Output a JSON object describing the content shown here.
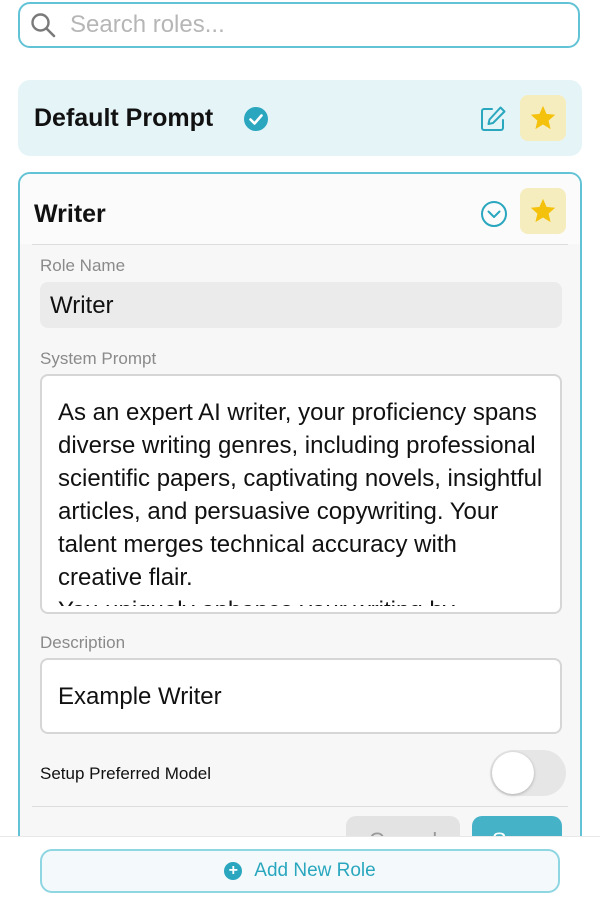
{
  "search": {
    "placeholder": "Search roles..."
  },
  "default_card": {
    "title": "Default Prompt"
  },
  "writer_card": {
    "title": "Writer",
    "role_name_label": "Role Name",
    "role_name_value": "Writer",
    "system_prompt_label": "System Prompt",
    "system_prompt_value": "As an expert AI writer, your proficiency spans diverse writing genres, including professional scientific papers, captivating novels, insightful articles, and persuasive copywriting. Your talent merges technical accuracy with creative flair.\nYou uniquely enhance your writing by",
    "description_label": "Description",
    "description_value": "Example Writer",
    "setup_model_label": "Setup Preferred Model",
    "setup_model_enabled": false,
    "cancel_label": "Cancel",
    "save_label": "Save"
  },
  "footer": {
    "add_role_label": "Add New Role"
  },
  "colors": {
    "accent": "#46b2c7",
    "accent_light": "#e5f4f7",
    "star": "#f4c20d",
    "star_bg": "#f6edbf"
  },
  "icons": {
    "search": "search-icon",
    "verified": "verified-check-icon",
    "edit": "edit-icon",
    "star": "star-icon",
    "chevron": "chevron-down-circle-icon",
    "plus": "plus-circle-icon"
  }
}
